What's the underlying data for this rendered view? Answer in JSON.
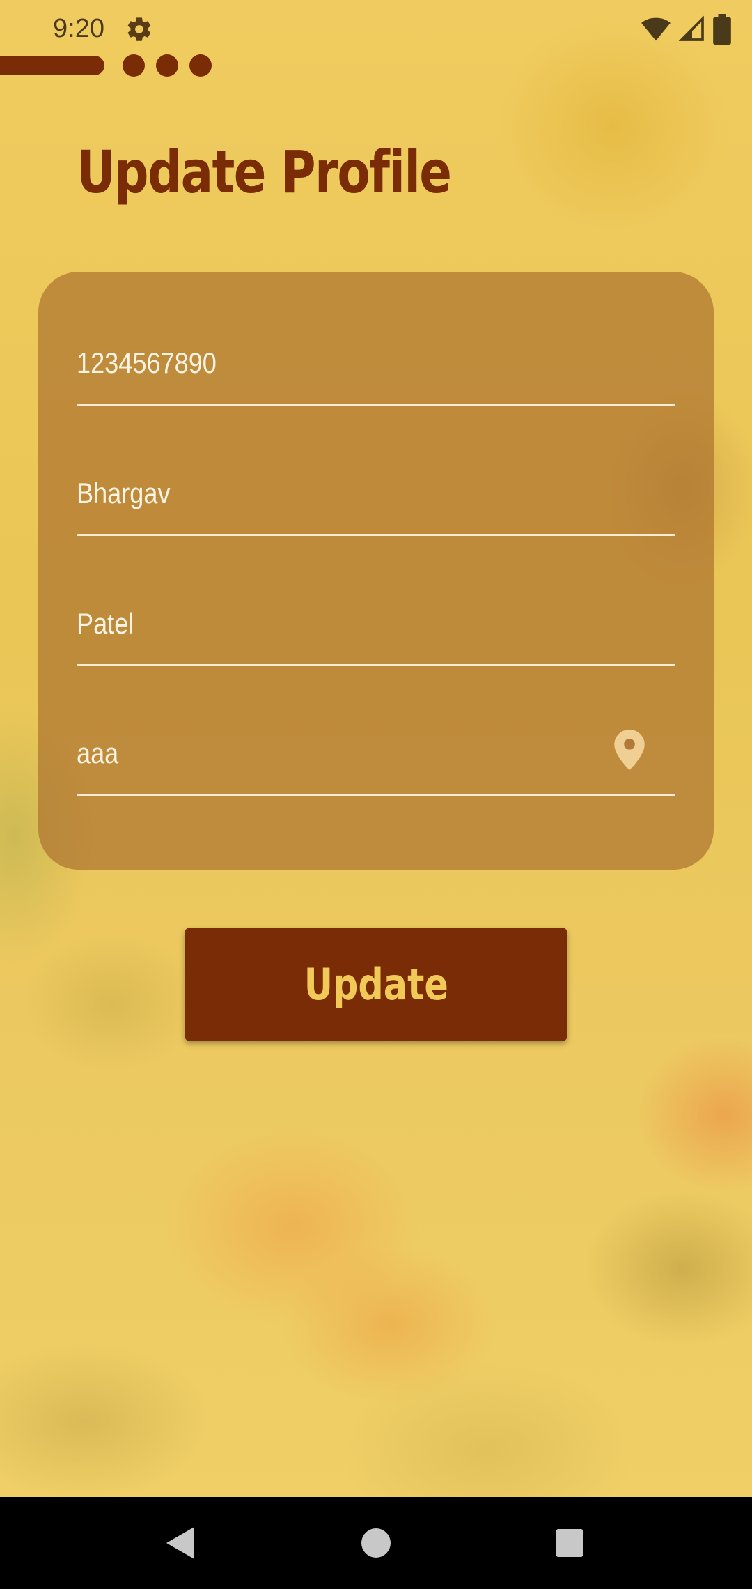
{
  "status_bar": {
    "time": "9:20",
    "icons": [
      "gear-icon",
      "wifi-icon",
      "signal-icon",
      "battery-icon"
    ]
  },
  "page_indicator": {
    "active_index": 0,
    "inactive_count": 3
  },
  "page": {
    "title": "Update Profile"
  },
  "form": {
    "phone": "1234567890",
    "first_name": "Bhargav",
    "last_name": "Patel",
    "address": "aaa",
    "address_icon": "location-pin-icon"
  },
  "actions": {
    "update_label": "Update"
  },
  "nav_bar": {
    "icons": [
      "back-icon",
      "home-icon",
      "recents-icon"
    ]
  },
  "colors": {
    "brand": "#7a2c06",
    "accent": "#f0c957",
    "background": "#ecc758",
    "card": "#aa6e2d",
    "field_text": "#fbf3e3"
  }
}
